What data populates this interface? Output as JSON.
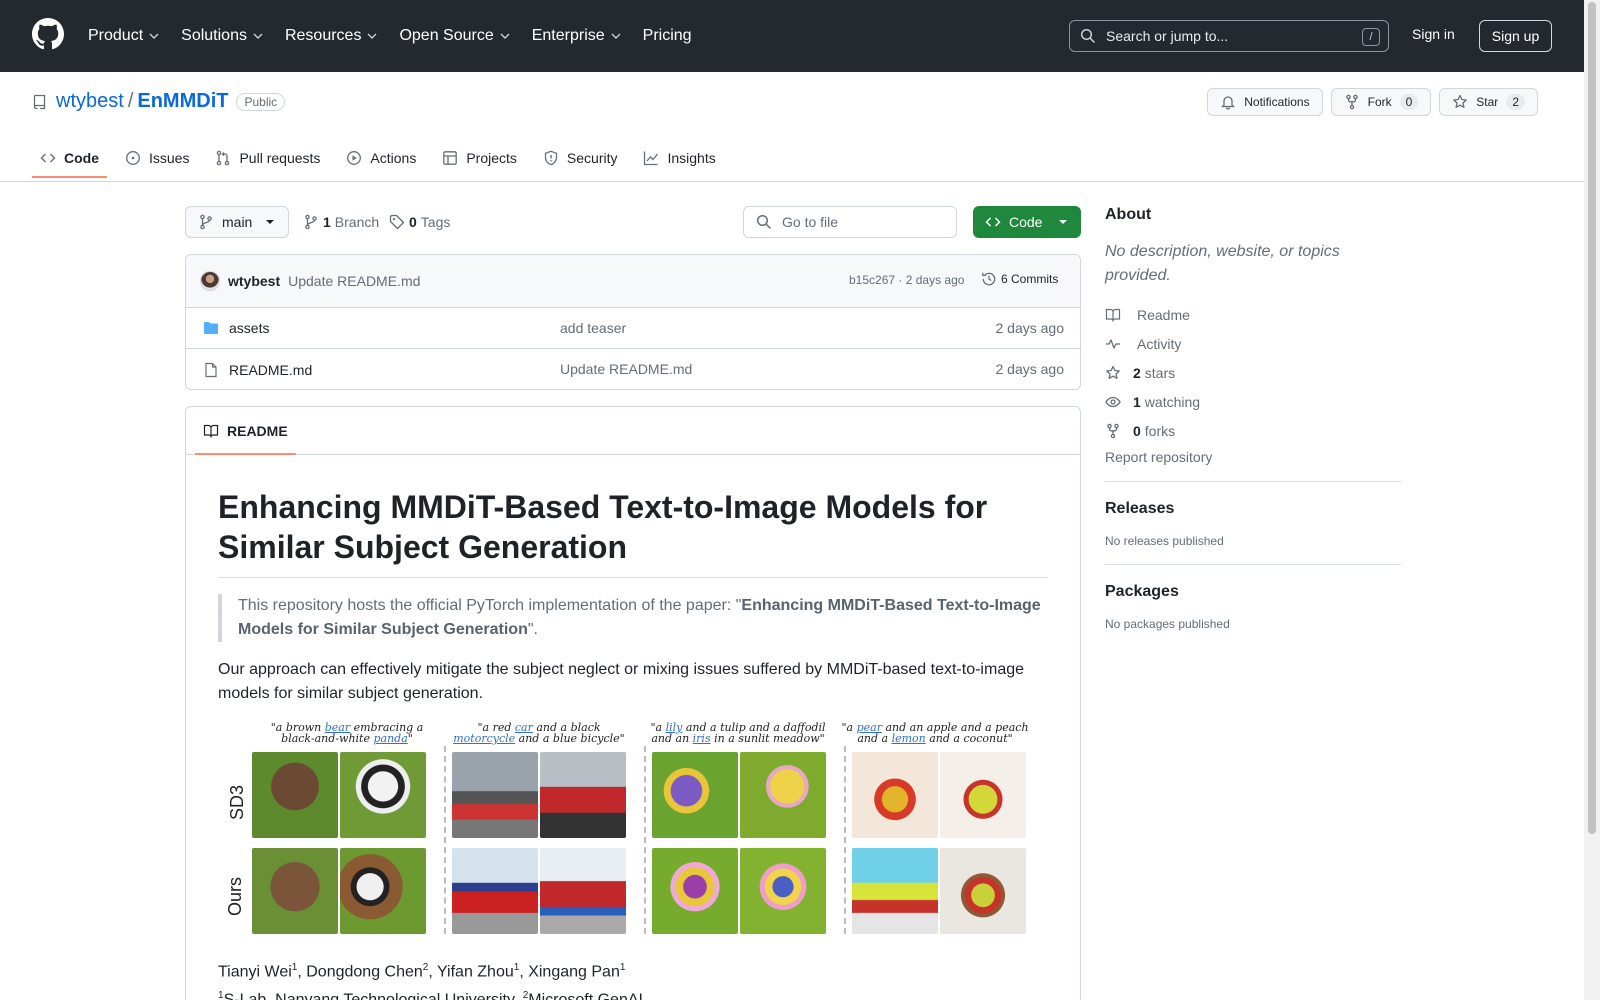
{
  "header": {
    "nav": [
      "Product",
      "Solutions",
      "Resources",
      "Open Source",
      "Enterprise",
      "Pricing"
    ],
    "search_placeholder": "Search or jump to...",
    "search_shortcut": "/",
    "signin": "Sign in",
    "signup": "Sign up"
  },
  "repo": {
    "owner": "wtybest",
    "separator": "/",
    "name": "EnMMDiT",
    "visibility": "Public",
    "notifications": "Notifications",
    "fork": "Fork",
    "fork_count": "0",
    "star": "Star",
    "star_count": "2"
  },
  "tabs": [
    "Code",
    "Issues",
    "Pull requests",
    "Actions",
    "Projects",
    "Security",
    "Insights"
  ],
  "branchbar": {
    "branch": "main",
    "branch_count": "1",
    "branch_label": "Branch",
    "tag_count": "0",
    "tag_label": "Tags",
    "goto_file": "Go to file",
    "code_button": "Code"
  },
  "latest_commit": {
    "author": "wtybest",
    "message": "Update README.md",
    "meta": "b15c267 · 2 days ago",
    "commits": "6 Commits"
  },
  "files": [
    {
      "name": "assets",
      "type": "folder",
      "commit": "add teaser",
      "date": "2 days ago"
    },
    {
      "name": "README.md",
      "type": "file",
      "commit": "Update README.md",
      "date": "2 days ago"
    }
  ],
  "readme": {
    "tab": "README",
    "title": "Enhancing MMDiT-Based Text-to-Image Models for Similar Subject Generation",
    "quote_prefix": "This repository hosts the official PyTorch implementation of the paper: \"",
    "quote_bold": "Enhancing MMDiT-Based Text-to-Image Models for Similar Subject Generation",
    "quote_suffix": "\".",
    "paragraph": "Our approach can effectively mitigate the subject neglect or mixing issues suffered by MMDiT-based text-to-image models for similar subject generation.",
    "teaser": {
      "row_labels": [
        "SD3",
        "Ours"
      ],
      "captions": [
        {
          "line1_pre": "\"a brown ",
          "line1_u": "bear",
          "line1_post": " embracing a",
          "line2_pre": "black-and-white ",
          "line2_u": "panda",
          "line2_post": "\""
        },
        {
          "line1_pre": "\"a red ",
          "line1_u": "car",
          "line1_post": " and a black",
          "line2_pre": "",
          "line2_u": "motorcycle",
          "line2_post": " and a blue bicycle\""
        },
        {
          "line1_pre": "\"a ",
          "line1_u": "lily",
          "line1_post": " and a tulip and a daffodil",
          "line2_pre": "and an ",
          "line2_u": "iris",
          "line2_post": " in a sunlit meadow\""
        },
        {
          "line1_pre": "\"a ",
          "line1_u": "pear",
          "line1_post": " and an apple and a peach",
          "line2_pre": "and a ",
          "line2_u": "lemon",
          "line2_post": " and a coconut\""
        }
      ]
    },
    "authors_line": [
      "Tianyi Wei",
      "1",
      ", Dongdong Chen",
      "2",
      ", Yifan Zhou",
      "1",
      ", Xingang Pan",
      "1"
    ],
    "affil_line": [
      "1",
      "S-Lab, Nanyang Technological University, ",
      "2",
      "Microsoft GenAI"
    ]
  },
  "sidebar": {
    "about": "About",
    "description": "No description, website, or topics provided.",
    "items": [
      {
        "icon": "book-icon",
        "bold": "",
        "label": "Readme"
      },
      {
        "icon": "pulse-icon",
        "bold": "",
        "label": "Activity"
      },
      {
        "icon": "star-icon",
        "bold": "2",
        "label": "stars"
      },
      {
        "icon": "eye-icon",
        "bold": "1",
        "label": "watching"
      },
      {
        "icon": "fork-icon",
        "bold": "0",
        "label": "forks"
      }
    ],
    "report": "Report repository",
    "releases": "Releases",
    "releases_empty": "No releases published",
    "packages": "Packages",
    "packages_empty": "No packages published"
  },
  "colors": {
    "header_bg": "#24292f",
    "link": "#0969da",
    "code_btn": "#1f883d",
    "tab_underline": "#fd8c73"
  }
}
